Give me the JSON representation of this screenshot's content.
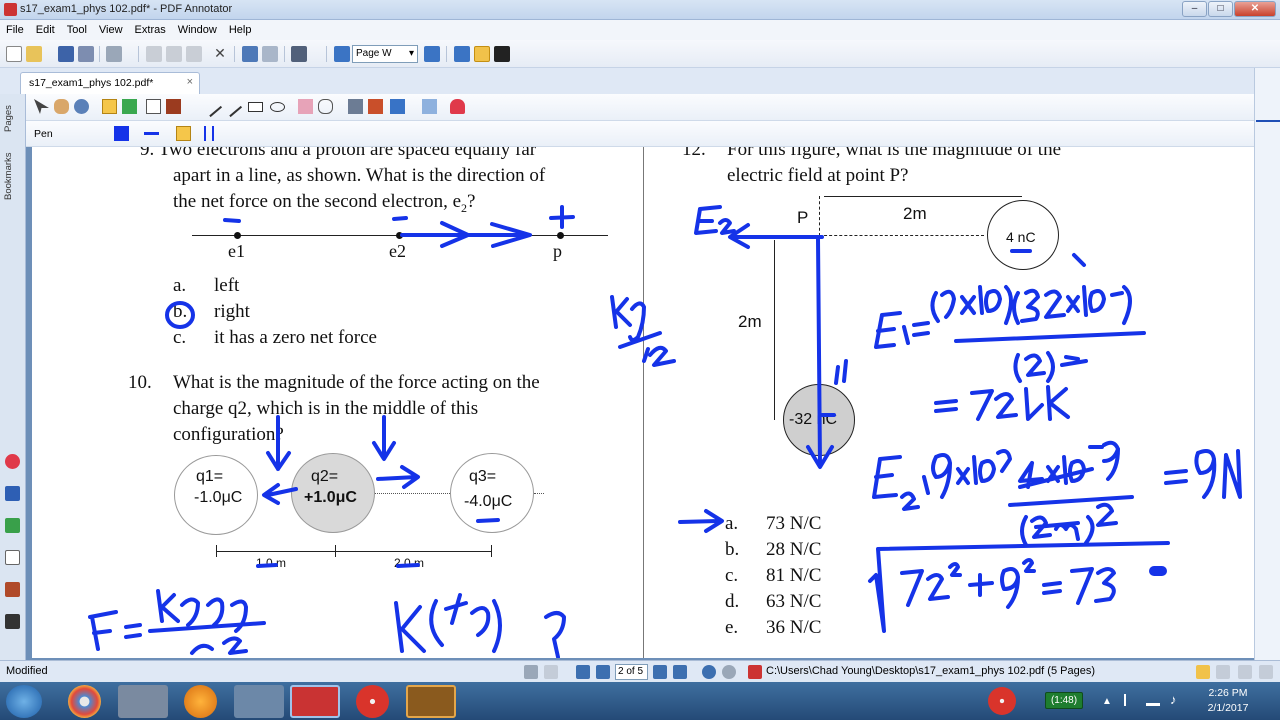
{
  "window": {
    "title": "s17_exam1_phys 102.pdf* - PDF Annotator",
    "controls": {
      "minimize": "–",
      "maximize": "□",
      "close": "✕"
    }
  },
  "menu": [
    "File",
    "Edit",
    "Tool",
    "View",
    "Extras",
    "Window",
    "Help"
  ],
  "toolbar": {
    "zoom_select": "Page W"
  },
  "tab": {
    "label": "s17_exam1_phys 102.pdf*",
    "close": "×"
  },
  "side_tabs": {
    "pages": "Pages",
    "bookmarks": "Bookmarks"
  },
  "pen_toolbar": {
    "label": "Pen"
  },
  "document": {
    "q9": {
      "line1": "9.    Two electrons and a proton are spaced equally far",
      "line2": "apart in a line, as shown. What is the direction of",
      "line3_a": "the net force on the second electron, e",
      "line3_sub": "2",
      "line3_b": "?",
      "labels": [
        "e1",
        "e2",
        "p"
      ],
      "answers": [
        {
          "letter": "a.",
          "text": "left"
        },
        {
          "letter": "b.",
          "text": "right"
        },
        {
          "letter": "c.",
          "text": "it has a zero net force"
        }
      ]
    },
    "q10": {
      "number": "10.",
      "line1": "What is the magnitude of the force acting on the",
      "line2": "charge q2,  which is in the middle of this",
      "line3": "configuration?",
      "charges": [
        {
          "name": "q1=",
          "value": "-1.0μC"
        },
        {
          "name": "q2=",
          "value": "+1.0μC"
        },
        {
          "name": "q3=",
          "value": "-4.0μC"
        }
      ],
      "distances": [
        "1.0 m",
        "2.0 m"
      ]
    },
    "q12": {
      "number": "12.",
      "line1": "For this figure, what is the magnitude of the",
      "line2": "electric field at point P?",
      "point": "P",
      "dist_h": "2m",
      "dist_v": "2m",
      "charge_top": "4 nC",
      "charge_bottom": "-32 nC",
      "answers": [
        {
          "letter": "a.",
          "text": "73 N/C"
        },
        {
          "letter": "b.",
          "text": "28 N/C"
        },
        {
          "letter": "c.",
          "text": "81 N/C"
        },
        {
          "letter": "d.",
          "text": "63 N/C"
        },
        {
          "letter": "e.",
          "text": "36 N/C"
        }
      ]
    },
    "ink": {
      "kq_over_r2": "kq / r2",
      "e2_label": "E2",
      "e1_label": "E1",
      "e1_formula": "E1 = (9×10^9)(32×10^-9) / (2)^2",
      "e1_result": "= 72N",
      "e2_formula": "E2 = 9×10^9 · 4×10^-9 / (2m)^2 = 9N",
      "sqrt": "√(72² + 9²) = 73",
      "force_formula": "F = kqq / r²",
      "kqq": "k(4q) q"
    }
  },
  "status": {
    "left": "Modified",
    "page": "2 of 5",
    "path": "C:\\Users\\Chad Young\\Desktop\\s17_exam1_phys 102.pdf (5 Pages)"
  },
  "taskbar": {
    "battery": "(1:48)",
    "time": "2:26 PM",
    "date": "2/1/2017"
  },
  "colors": {
    "ink": "#1533e8",
    "accent": "#3d6fb0"
  }
}
